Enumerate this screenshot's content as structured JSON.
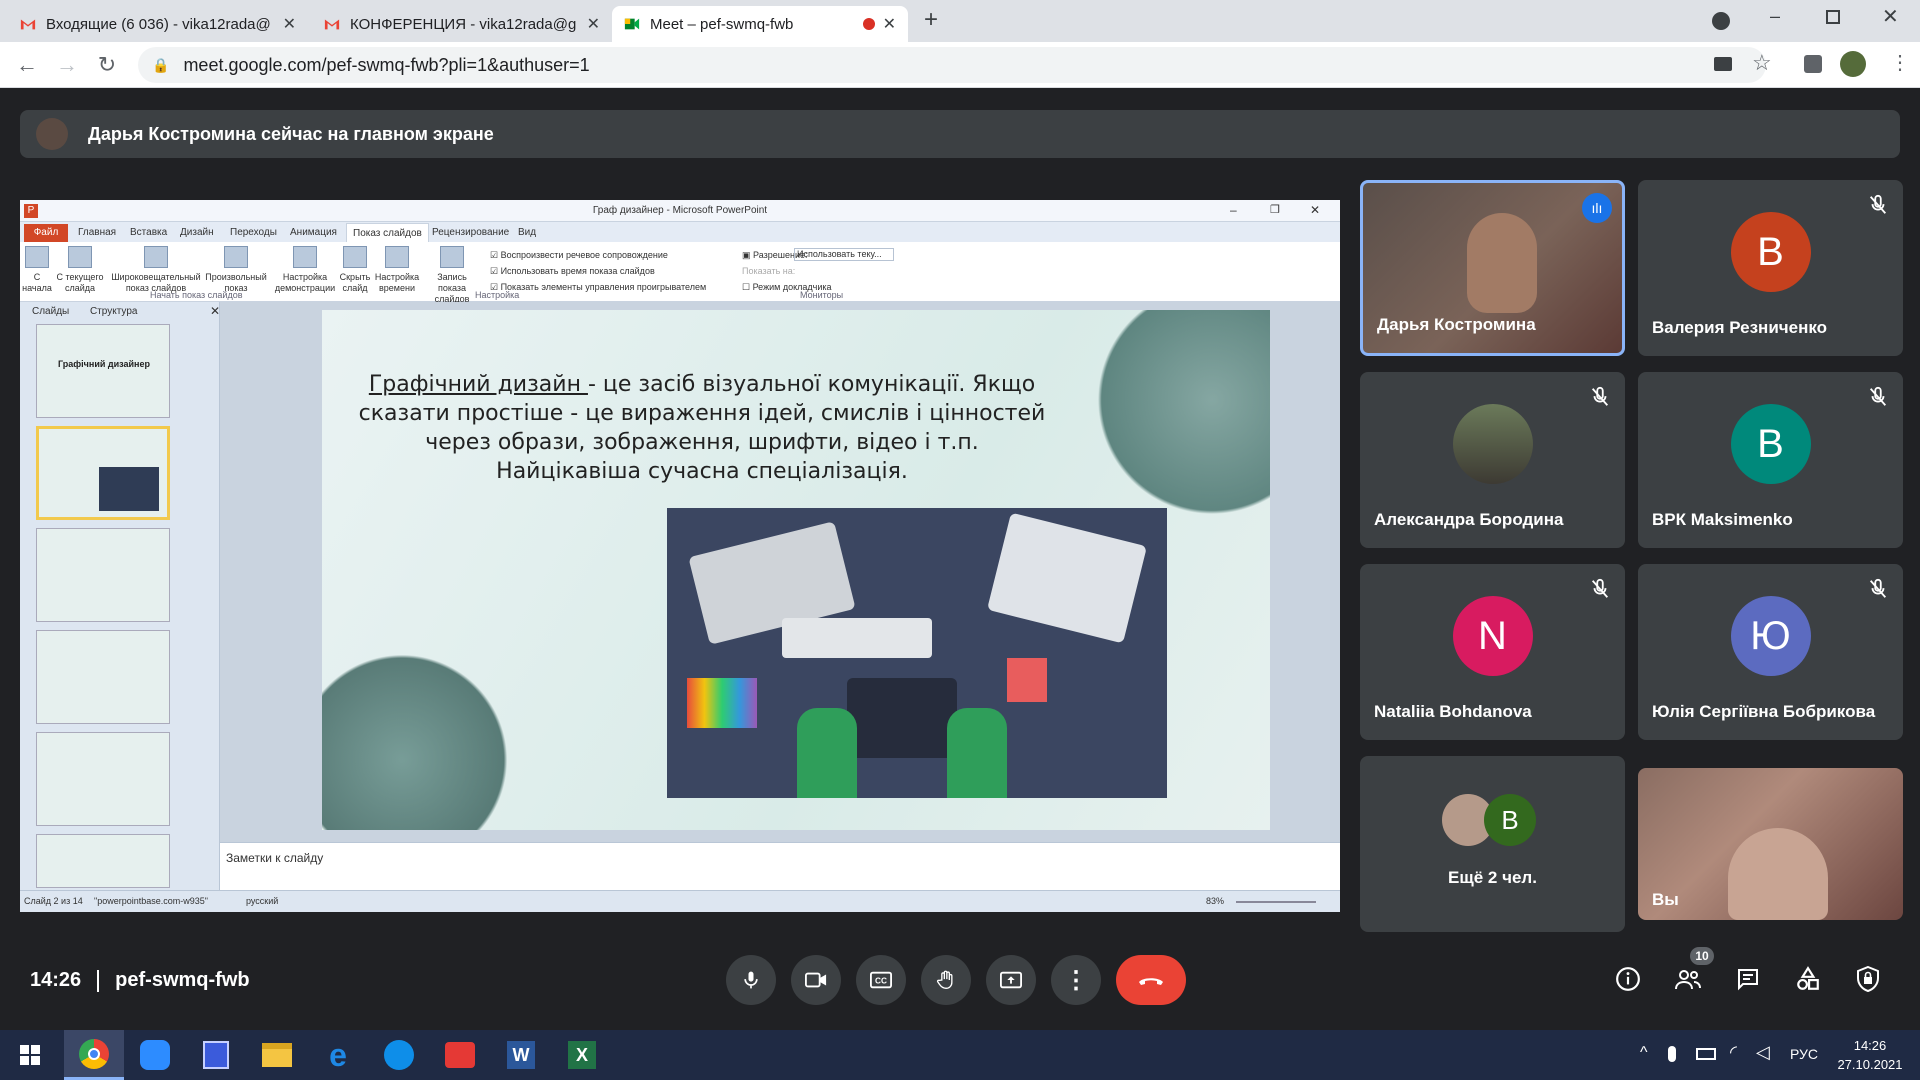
{
  "browser": {
    "tabs": [
      {
        "title": "Входящие (6 036) - vika12rada@",
        "icon": "gmail-icon"
      },
      {
        "title": "КОНФЕРЕНЦИЯ - vika12rada@g",
        "icon": "gmail-icon"
      },
      {
        "title": "Meet – pef-swmq-fwb",
        "icon": "meet-icon"
      }
    ],
    "url": "meet.google.com/pef-swmq-fwb?pli=1&authuser=1"
  },
  "meet": {
    "banner": "Дарья Костромина сейчас на главном экране",
    "time": "14:26",
    "meeting_code": "pef-swmq-fwb",
    "participants_count": "10",
    "participants": [
      {
        "name": "Дарья Костромина",
        "type": "video"
      },
      {
        "name": "Валерия Резниченко",
        "initial": "В",
        "color": "#c5411e"
      },
      {
        "name": "Александра Бородина",
        "type": "photo"
      },
      {
        "name": "ВРК Maksimenko",
        "initial": "В",
        "color": "#00897b"
      },
      {
        "name": "Nataliia Bohdanova",
        "initial": "N",
        "color": "#d81b60"
      },
      {
        "name": "Юлія Сергіївна Бобрикова",
        "initial": "Ю",
        "color": "#5c6bc0"
      },
      {
        "name": "Ещё 2 чел.",
        "initial": "В",
        "color": "#33691e"
      },
      {
        "name": "Вы",
        "type": "video"
      }
    ]
  },
  "ppt": {
    "title": "Граф дизайнер - Microsoft PowerPoint",
    "tabs": [
      "Файл",
      "Главная",
      "Вставка",
      "Дизайн",
      "Переходы",
      "Анимация",
      "Показ слайдов",
      "Рецензирование",
      "Вид"
    ],
    "ribbon": {
      "b1": "С начала",
      "b2": "С текущего слайда",
      "b3": "Широковещательный показ слайдов",
      "b4": "Произвольный показ",
      "b5": "Настройка демонстрации",
      "b6": "Скрыть слайд",
      "b7": "Настройка времени",
      "b8": "Запись показа слайдов",
      "c1": "Воспроизвести речевое сопровождение",
      "c2": "Использовать время показа слайдов",
      "c3": "Показать элементы управления проигрывателем",
      "r1": "Разрешение:",
      "r1v": "Использовать теку...",
      "r2": "Показать на:",
      "r3": "Режим докладчика",
      "g1": "Начать показ слайдов",
      "g2": "Настройка",
      "g3": "Мониторы"
    },
    "panel_tabs": [
      "Слайды",
      "Структура"
    ],
    "thumb1_title": "Графічний дизайнер",
    "slide_heading_link": "Графічний дизайн ",
    "slide_text_1": "- це засіб візуальної комунікації. Якщо",
    "slide_text_2": "сказати простіше - це вираження ідей, смислів і цінностей",
    "slide_text_3": "через образи, зображення, шрифти, відео і т.п.",
    "slide_text_4": "Найцікавіша сучасна спеціалізація.",
    "notes": "Заметки к слайду",
    "status_slide": "Слайд 2 из 14",
    "status_theme": "\"powerpointbase.com-w935\"",
    "status_lang": "русский",
    "zoom": "83%"
  },
  "taskbar": {
    "lang": "РУС",
    "time": "14:26",
    "date": "27.10.2021"
  }
}
